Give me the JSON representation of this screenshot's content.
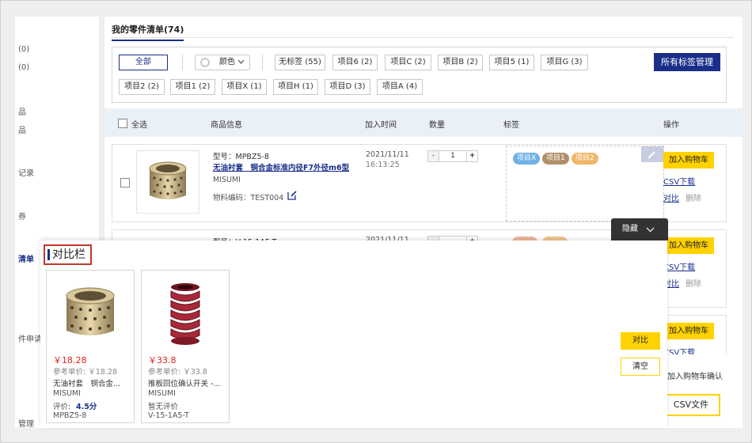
{
  "sidebar": {
    "items": [
      "(0)",
      "(0)",
      "品",
      "品",
      "记录",
      "券",
      "清单",
      "件申请",
      "管理"
    ]
  },
  "page": {
    "title": "我的零件清单(74)"
  },
  "filter": {
    "all": "全部",
    "color": "颜色",
    "manage": "所有标签管理",
    "row1": [
      "无标签 (55)",
      "项目6 (2)",
      "项目C (2)",
      "项目B (2)",
      "项目5 (1)",
      "项目G (3)"
    ],
    "row2": [
      "项目2 (2)",
      "项目1 (2)",
      "项目X (1)",
      "项目H (1)",
      "项目D (3)",
      "项目A (4)"
    ]
  },
  "table": {
    "select_all": "全选",
    "headers": [
      "商品信息",
      "加入时间",
      "数量",
      "标签",
      "操作"
    ]
  },
  "row1": {
    "model": "型号：MPBZ5-8",
    "name": "无油衬套　铜合金标准内径F7外径m6型",
    "brand": "MISUMI",
    "code": "物料编码：TEST004",
    "date": "2021/11/11",
    "time": "16:13:25",
    "qty": "1",
    "tags": [
      "项目X",
      "项目1",
      "项目2"
    ],
    "tag_colors": [
      "#6fb0e6",
      "#b0906a",
      "#f0b768"
    ]
  },
  "row2": {
    "model": "型号：V-15-1A5-T",
    "date": "2021/11/11"
  },
  "actions": {
    "add_cart": "加入购物车",
    "csv": "CSV下载",
    "compare": "对比",
    "delete": "删除"
  },
  "hide_tab": {
    "label": "隐藏"
  },
  "compare": {
    "title": "对比栏",
    "compare_btn": "对比",
    "clear_btn": "清空",
    "cards": [
      {
        "price": "￥18.28",
        "ref": "参考单价: ￥18.28",
        "name": "无油衬套　铜合金...",
        "brand": "MISUMI",
        "rating_label": "评价:",
        "rating": "4.5分",
        "model": "MPBZ5-8"
      },
      {
        "price": "￥33.8",
        "ref": "参考单价: ￥33.8",
        "name": "推板回位确认开关 -...",
        "brand": "MISUMI",
        "rating_label": "暂无评价",
        "model": "V-15-1A5-T"
      }
    ]
  },
  "right_panel": {
    "confirm": "加入购物车确认",
    "csv_file": "CSV文件"
  }
}
